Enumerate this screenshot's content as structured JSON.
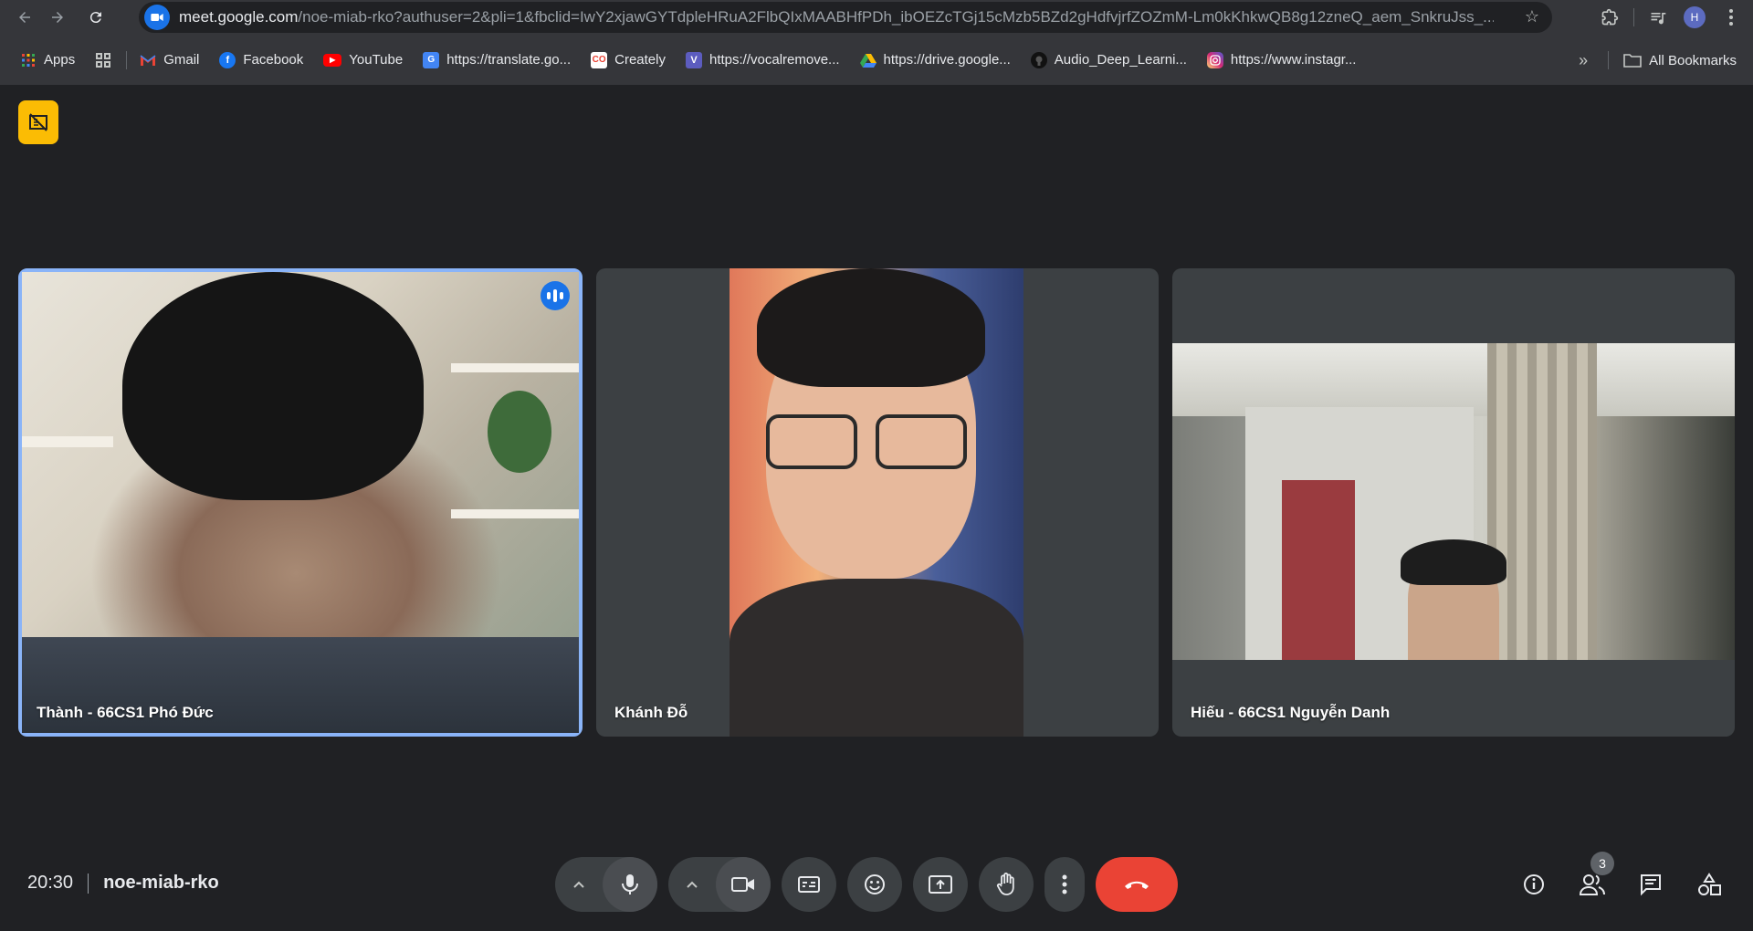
{
  "browser": {
    "url_host": "meet.google.com",
    "url_path": "/noe-miab-rko?authuser=2&pli=1&fbclid=IwY2xjawGYTdpleHRuA2FlbQIxMAABHfPDh_ibOEZcTGj15cMzb5BZd2gHdfvjrfZOZmM-Lm0kKhkwQB8g12zneQ_aem_SnkruJss_...",
    "profile_initial": "H"
  },
  "bookmarks": {
    "items": [
      {
        "label": "Apps",
        "icon": "apps-grid-icon"
      },
      {
        "label": "Gmail",
        "icon": "gmail-icon"
      },
      {
        "label": "Facebook",
        "icon": "facebook-icon"
      },
      {
        "label": "YouTube",
        "icon": "youtube-icon"
      },
      {
        "label": "https://translate.go...",
        "icon": "translate-icon"
      },
      {
        "label": "Creately",
        "icon": "creately-icon"
      },
      {
        "label": "https://vocalremove...",
        "icon": "vocalremover-icon"
      },
      {
        "label": "https://drive.google...",
        "icon": "drive-icon"
      },
      {
        "label": "Audio_Deep_Learni...",
        "icon": "github-icon"
      },
      {
        "label": "https://www.instagr...",
        "icon": "instagram-icon"
      }
    ],
    "all_bookmarks_label": "All Bookmarks"
  },
  "meeting": {
    "time": "20:30",
    "code": "noe-miab-rko",
    "participant_count": "3",
    "participants": [
      {
        "name": "Thành - 66CS1 Phó Đức",
        "speaking": true
      },
      {
        "name": "Khánh Đỗ",
        "speaking": false
      },
      {
        "name": "Hiếu - 66CS1 Nguyễn Danh",
        "speaking": false
      }
    ]
  },
  "colors": {
    "background": "#202124",
    "tile": "#3c4043",
    "speaking_outline": "#8ab4f8",
    "end_call": "#ea4335",
    "camera_off_badge": "#fbbc04"
  }
}
